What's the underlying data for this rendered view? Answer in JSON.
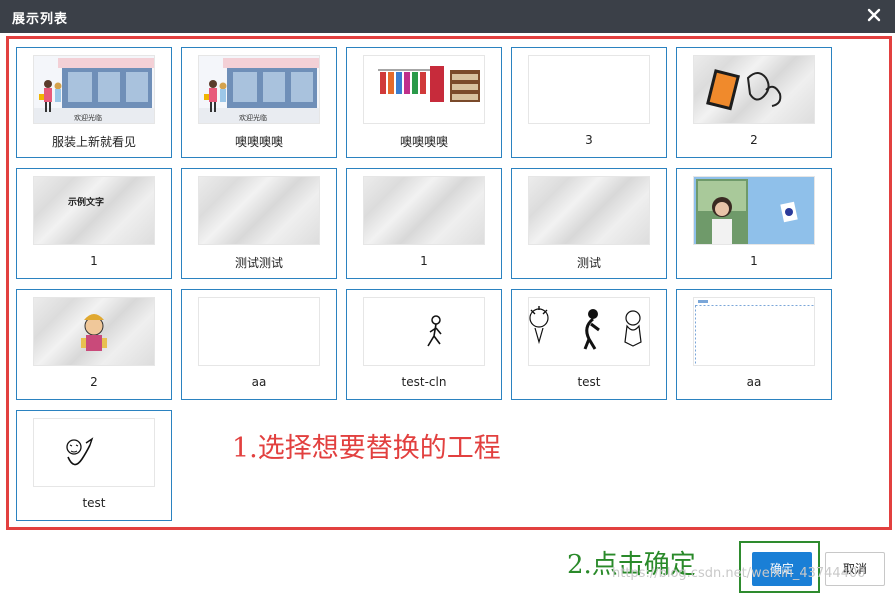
{
  "dialog": {
    "title": "展示列表",
    "close_icon": "close-icon"
  },
  "projects": [
    {
      "label": "服装上新就看见",
      "thumb": "shop-street-scene"
    },
    {
      "label": "噢噢噢噢",
      "thumb": "shop-street-scene"
    },
    {
      "label": "噢噢噢噢",
      "thumb": "clothing-rack"
    },
    {
      "label": "3",
      "thumb": "blank"
    },
    {
      "label": "2",
      "thumb": "paper-with-cards"
    },
    {
      "label": "1",
      "thumb": "paper-with-text",
      "thumb_text": "示例文字"
    },
    {
      "label": "测试测试",
      "thumb": "paper"
    },
    {
      "label": "1",
      "thumb": "paper"
    },
    {
      "label": "测试",
      "thumb": "paper"
    },
    {
      "label": "1",
      "thumb": "photo-portrait"
    },
    {
      "label": "2",
      "thumb": "paper-with-cartoon"
    },
    {
      "label": "aa",
      "thumb": "blank"
    },
    {
      "label": "test-cln",
      "thumb": "sketch-figure"
    },
    {
      "label": "test",
      "thumb": "sketch-characters"
    },
    {
      "label": "aa",
      "thumb": "dotted-frame"
    },
    {
      "label": "test",
      "thumb": "sketch-doodle"
    }
  ],
  "annotations": {
    "step1": "1.选择想要替换的工程",
    "step2": "2.点击确定"
  },
  "buttons": {
    "confirm": "确定",
    "cancel": "取消"
  },
  "watermark": "https://blog.csdn.net/weixin_43744400",
  "colors": {
    "titlebar": "#3b4048",
    "card_border": "#2b82c0",
    "highlight_red": "#e2403f",
    "highlight_green": "#2e8b2e",
    "primary_button": "#1a7fd6"
  }
}
